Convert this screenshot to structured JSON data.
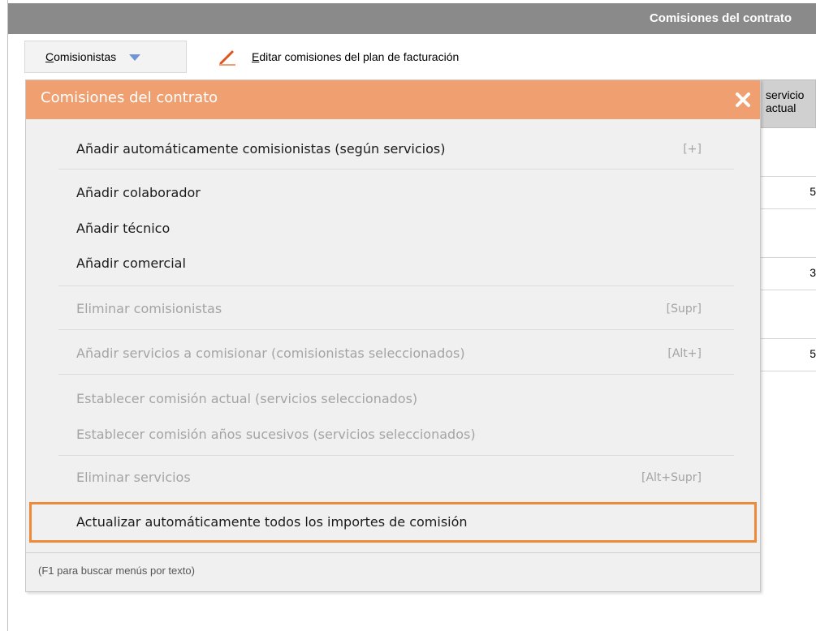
{
  "window": {
    "title": "Comisiones del contrato"
  },
  "toolbar": {
    "comisionistas_prefix": "C",
    "comisionistas_rest": "omisionistas",
    "edit_prefix": "E",
    "edit_rest": "ditar comisiones del plan de facturación"
  },
  "background_table": {
    "header": "servicio actual",
    "cells": [
      "5",
      "3",
      "5"
    ]
  },
  "popup": {
    "title": "Comisiones del contrato",
    "items": [
      {
        "label": "Añadir automáticamente comisionistas (según servicios)",
        "shortcut": "[+]"
      },
      {
        "label": "Añadir colaborador",
        "shortcut": ""
      },
      {
        "label": "Añadir técnico",
        "shortcut": ""
      },
      {
        "label": "Añadir comercial",
        "shortcut": ""
      },
      {
        "label": "Eliminar comisionistas",
        "shortcut": "[Supr]"
      },
      {
        "label": "Añadir servicios a comisionar (comisionistas seleccionados)",
        "shortcut": "[Alt+]"
      },
      {
        "label": "Establecer comisión actual (servicios seleccionados)",
        "shortcut": ""
      },
      {
        "label": "Establecer comisión años sucesivos (servicios seleccionados)",
        "shortcut": ""
      },
      {
        "label": "Eliminar servicios",
        "shortcut": "[Alt+Supr]"
      },
      {
        "label": "Actualizar automáticamente todos los importes de comisión",
        "shortcut": ""
      }
    ],
    "footer": "(F1 para buscar menús por texto)"
  },
  "colors": {
    "titlebar": "#8a8a8a",
    "popup_header": "#f0a070",
    "highlight_border": "#ec8a3a",
    "disabled_text": "#a4a4a4"
  }
}
